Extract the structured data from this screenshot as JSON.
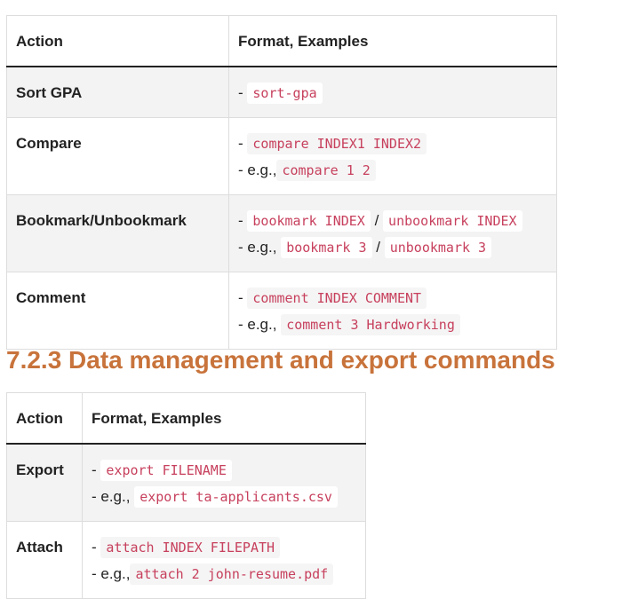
{
  "table1": {
    "headers": [
      "Action",
      "Format, Examples"
    ],
    "rows": [
      {
        "action": "Sort GPA",
        "line1_dash": "-",
        "cmd": "sort-gpa"
      },
      {
        "action": "Compare",
        "line1_dash": "-",
        "cmd": "compare INDEX1 INDEX2",
        "eg_label": "- e.g.,",
        "eg": "compare 1 2"
      },
      {
        "action": "Bookmark/Unbookmark",
        "line1_dash": "-",
        "cmd": "bookmark INDEX",
        "sep": "/",
        "cmd2": "unbookmark INDEX",
        "eg_label": "- e.g.,",
        "eg": "bookmark 3",
        "eg2": "unbookmark 3"
      },
      {
        "action": "Comment",
        "line1_dash": "-",
        "cmd": "comment INDEX COMMENT",
        "eg_label": "- e.g.,",
        "eg": "comment 3 Hardworking"
      }
    ]
  },
  "section_heading": "7.2.3 Data management and export commands",
  "table2": {
    "headers": [
      "Action",
      "Format, Examples"
    ],
    "rows": [
      {
        "action": "Export",
        "line1_dash": "-",
        "cmd": "export FILENAME",
        "eg_label": "- e.g.,",
        "eg": "export ta-applicants.csv"
      },
      {
        "action": "Attach",
        "line1_dash": "-",
        "cmd": "attach INDEX FILEPATH",
        "eg_label": "- e.g.,",
        "eg": "attach 2 john-resume.pdf"
      }
    ]
  },
  "colors": {
    "code_text": "#c7405d",
    "heading": "#c8733b",
    "row_shade": "#f3f3f3",
    "border": "#dddddd"
  }
}
